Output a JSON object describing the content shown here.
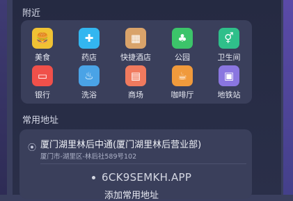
{
  "nearby": {
    "title": "附近",
    "items": [
      {
        "label": "美食",
        "icon": "burger-icon",
        "glyph": "🍔",
        "color": "#f0c234"
      },
      {
        "label": "药店",
        "icon": "pharmacy-icon",
        "glyph": "✚",
        "color": "#33b6f0"
      },
      {
        "label": "快捷酒店",
        "icon": "hotel-icon",
        "glyph": "▦",
        "color": "#d9a36a"
      },
      {
        "label": "公园",
        "icon": "park-icon",
        "glyph": "♣",
        "color": "#3cc46a"
      },
      {
        "label": "卫生间",
        "icon": "restroom-icon",
        "glyph": "⚥",
        "color": "#2fbf8a"
      },
      {
        "label": "银行",
        "icon": "bank-card-icon",
        "glyph": "▭",
        "color": "#f0504a"
      },
      {
        "label": "洗浴",
        "icon": "bathtub-icon",
        "glyph": "♨",
        "color": "#4aa3e6"
      },
      {
        "label": "商场",
        "icon": "mall-icon",
        "glyph": "▤",
        "color": "#f07a5e"
      },
      {
        "label": "咖啡厅",
        "icon": "coffee-icon",
        "glyph": "☕",
        "color": "#f09a3c"
      },
      {
        "label": "地铁站",
        "icon": "subway-icon",
        "glyph": "▣",
        "color": "#8a76e0"
      }
    ]
  },
  "common": {
    "title": "常用地址",
    "address": {
      "name": "厦门湖里林后中通(厦门湖里林后营业部)",
      "detail": "厦门市-湖里区-林后社589号102",
      "icon": "location-pin-icon"
    },
    "add_label": "添加常用地址"
  },
  "watermark": "6CK9SEMKH.APP"
}
